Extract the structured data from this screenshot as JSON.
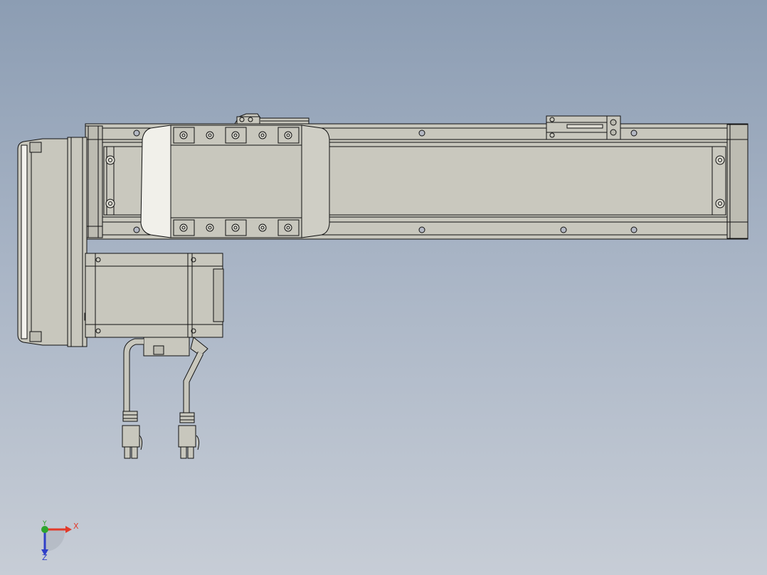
{
  "viewport": {
    "background_top": "#8c9db3",
    "background_bottom": "#c7cdd6"
  },
  "colors": {
    "part_fill": "#c8c7bd",
    "part_light": "#dedcd3",
    "part_dark": "#a9a89f",
    "edge": "#111111",
    "axis_x": "#e23a2a",
    "axis_y": "#2da52d",
    "axis_z": "#2f3fc8"
  },
  "triad": {
    "x_label": "X",
    "y_label": "Y",
    "z_label": "Z"
  }
}
